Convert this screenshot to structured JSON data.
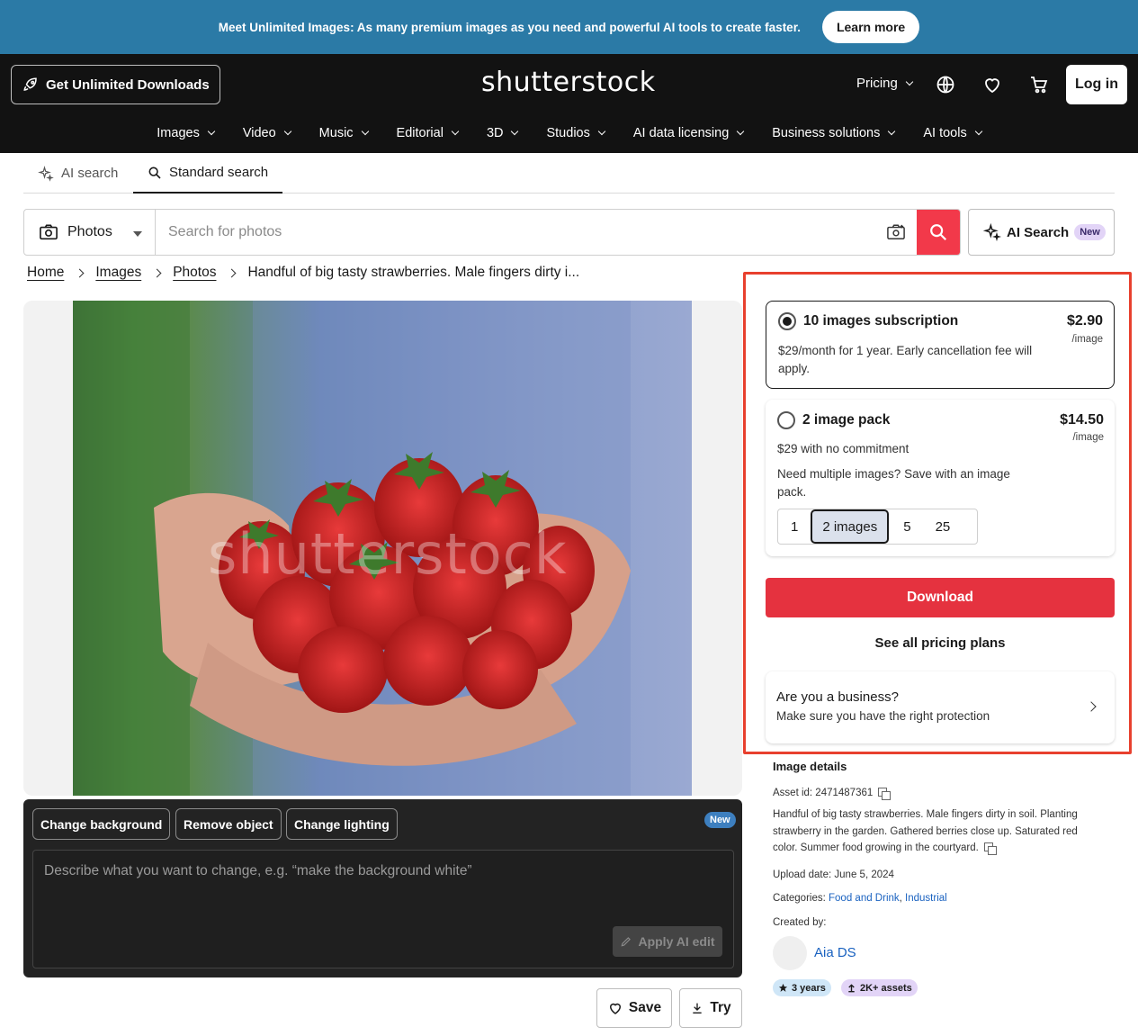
{
  "banner": {
    "text": "Meet Unlimited Images: As many premium images as you need and powerful AI tools to create faster.",
    "cta": "Learn more"
  },
  "header": {
    "unlimited_btn": "Get Unlimited Downloads",
    "logo": "shutterstock",
    "pricing": "Pricing",
    "login": "Log in",
    "icons": [
      "globe-icon",
      "heart-icon",
      "cart-icon"
    ]
  },
  "nav": {
    "items": [
      "Images",
      "Video",
      "Music",
      "Editorial",
      "3D",
      "Studios",
      "AI data licensing",
      "Business solutions",
      "AI tools"
    ]
  },
  "search_tabs": {
    "ai": "AI search",
    "standard": "Standard search"
  },
  "search": {
    "type": "Photos",
    "placeholder": "Search for photos",
    "ai_button": "AI Search",
    "ai_badge": "New"
  },
  "breadcrumb": {
    "home": "Home",
    "images": "Images",
    "photos": "Photos",
    "current": "Handful of big tasty strawberries. Male fingers dirty i..."
  },
  "preview": {
    "watermark": "shutterstock"
  },
  "ai_edit": {
    "chips": [
      "Change background",
      "Remove object",
      "Change lighting"
    ],
    "badge": "New",
    "placeholder": "Describe what you want to change, e.g. “make the background white”",
    "apply": "Apply AI edit"
  },
  "actions": {
    "save": "Save",
    "try": "Try"
  },
  "pricing_panel": {
    "subscription": {
      "title": "10 images subscription",
      "price": "$2.90",
      "unit": "/image",
      "desc": "$29/month for 1 year. Early cancellation fee will apply."
    },
    "pack": {
      "title": "2 image pack",
      "price": "$14.50",
      "unit": "/image",
      "desc": "$29 with no commitment",
      "note": "Need multiple images? Save with an image pack.",
      "options": [
        "1",
        "2 images",
        "5",
        "25"
      ],
      "selected": "2 images"
    },
    "download": "Download",
    "see_all": "See all pricing plans",
    "business": {
      "title": "Are you a business?",
      "subtitle": "Make sure you have the right protection"
    }
  },
  "details": {
    "heading": "Image details",
    "asset_id": "Asset id: 2471487361",
    "description": "Handful of big tasty strawberries. Male fingers dirty in soil. Planting strawberry in the garden. Gathered berries close up. Saturated red color. Summer food growing in the courtyard.",
    "upload_date": "Upload date: June 5, 2024",
    "categories_label": "Categories:",
    "category_1": "Food and Drink",
    "category_2": "Industrial",
    "created_by": "Created by:",
    "creator": "Aia DS",
    "badge_years": "3 years",
    "badge_assets": "2K+ assets"
  },
  "colors": {
    "banner": "#2b7aa6",
    "header": "#121212",
    "accent_red": "#e5323f",
    "highlight": "#e8402e",
    "link": "#1a62c0"
  }
}
